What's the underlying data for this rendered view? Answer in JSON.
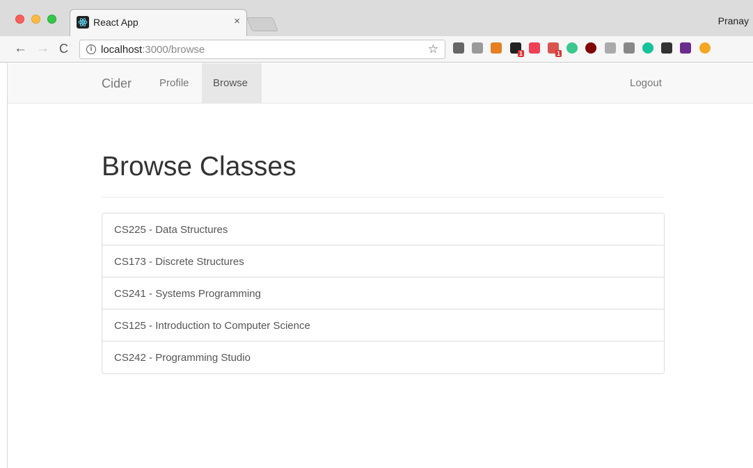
{
  "browser": {
    "tab_title": "React App",
    "tab_close": "×",
    "profile_name": "Pranay",
    "url_host": "localhost",
    "url_rest": ":3000/browse",
    "back": "←",
    "forward": "→",
    "reload": "C",
    "info": "i",
    "star": "☆",
    "extensions": [
      {
        "icon": "cast-icon",
        "color": "#666666"
      },
      {
        "icon": "extension-h-icon",
        "color": "#9a9a9a"
      },
      {
        "icon": "eyedropper-icon",
        "color": "#e67e22"
      },
      {
        "icon": "chat-extension-icon",
        "color": "#222222",
        "badge": "1"
      },
      {
        "icon": "pocket-icon",
        "color": "#ef4056"
      },
      {
        "icon": "calendar-extension-icon",
        "color": "#d9534f",
        "badge": "1"
      },
      {
        "icon": "ring-extension-icon",
        "color": "#3cc78f"
      },
      {
        "icon": "ublock-icon",
        "color": "#800000"
      },
      {
        "icon": "grid-extension-icon",
        "color": "#aaaaaa"
      },
      {
        "icon": "face-extension-icon",
        "color": "#888888"
      },
      {
        "icon": "grammarly-icon",
        "color": "#15c39a"
      },
      {
        "icon": "screen-extension-icon",
        "color": "#333333"
      },
      {
        "icon": "bars-extension-icon",
        "color": "#6b2c8f"
      },
      {
        "icon": "warning-extension-icon",
        "color": "#f5a623"
      }
    ]
  },
  "navbar": {
    "brand": "Cider",
    "profile": "Profile",
    "browse": "Browse",
    "logout": "Logout"
  },
  "main": {
    "heading": "Browse Classes",
    "classes": [
      "CS225 - Data Structures",
      "CS173 - Discrete Structures",
      "CS241 - Systems Programming",
      "CS125 - Introduction to Computer Science",
      "CS242 - Programming Studio"
    ]
  }
}
